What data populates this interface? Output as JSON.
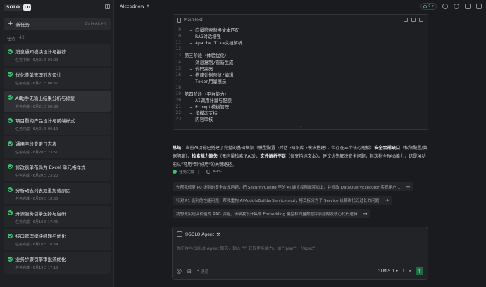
{
  "sidebar": {
    "logo_text": "SOLO",
    "logo_badge": "CD",
    "new_task": {
      "label": "新任务",
      "shortcut": "Ctrl+Alt+N"
    },
    "task_count_label": "任务",
    "task_count": "43",
    "tasks": [
      {
        "title": "消息通知模块设计与推荐",
        "meta": "任务中断 · 6月21日 03:09",
        "status": "done",
        "active": false
      },
      {
        "title": "优化菜单管理列表设计",
        "meta": "任务完成 · 6月21日 00:52",
        "status": "done",
        "active": false
      },
      {
        "title": "AI助手无输出结果分析与修复",
        "meta": "任务完成 · 6月21日 00:36",
        "status": "done",
        "active": true
      },
      {
        "title": "项目重构产品设计与前端样式",
        "meta": "任务完成 · 6月21日 00:19",
        "status": "done",
        "active": false
      },
      {
        "title": "通用字段变更日志表",
        "meta": "任务完成 · 6月20日 23:51",
        "status": "done",
        "active": false
      },
      {
        "title": "修改表单布局为 Excel 单元格样式",
        "meta": "任务完成 · 6月20日 23:20",
        "status": "done",
        "active": false
      },
      {
        "title": "分析动态列表双重加载原因",
        "meta": "任务完成 · 6月20日 18:50",
        "status": "done",
        "active": false
      },
      {
        "title": "开源服务引擎选择与启研",
        "meta": "任务完成 · 6月18日 17:45",
        "status": "done",
        "active": false
      },
      {
        "title": "接口管理模块问题与优化",
        "meta": "任务完成 · 6月18日 16:54",
        "status": "done",
        "active": false
      },
      {
        "title": "业务步骤引擎审批流优化",
        "meta": "任务完成 · 6月15日 17:15",
        "status": "done",
        "active": false
      }
    ]
  },
  "topbar": {
    "project": "AIccodnew",
    "pill_count": "0"
  },
  "code_block": {
    "lang": "PlainText",
    "lines": [
      {
        "n": "9",
        "t": "  → 向量检索替换文本匹配"
      },
      {
        "n": "10",
        "t": "  → RAG对话增强"
      },
      {
        "n": "11",
        "t": "  → Apache Tika文档解析"
      },
      {
        "n": "12",
        "t": ""
      },
      {
        "n": "13",
        "t": "第三阶段（体验优化）："
      },
      {
        "n": "14",
        "t": "  → 消息复制/重新生成"
      },
      {
        "n": "15",
        "t": "  → 代码高亮"
      },
      {
        "n": "16",
        "t": "  → 搭建计划预览/编辑"
      },
      {
        "n": "17",
        "t": "  → Token用量展示"
      },
      {
        "n": "18",
        "t": ""
      },
      {
        "n": "19",
        "t": "第四阶段（平台能力）："
      },
      {
        "n": "20",
        "t": "  → AI调用计量与配额"
      },
      {
        "n": "21",
        "t": "  → Prompt模板管理"
      },
      {
        "n": "22",
        "t": "  → 多模态支持"
      },
      {
        "n": "23",
        "t": "  → 内容审核"
      }
    ]
  },
  "summary": {
    "p1": "总结",
    "p2": "：当前AI功能已搭建了完整的基础框架（模型配置→对话→知识库→模块搭建），但存在三个核心短板：",
    "p3": "安全合规缺口",
    "p4": "（权限配置/数据隔离）、",
    "p5": "检索能力缺失",
    "p6": "（无向量检索/RAG）、",
    "p7": "文件解析不足",
    "p8": "（仅支持纯文本）。建议优先解决安全问题，其次补全RAG能力，这是AI功能从\"可用\"到\"好用\"的关键路径。"
  },
  "status": {
    "label": "任务完成",
    "progress": "49%"
  },
  "suggestions": [
    "先帮我修复 P0 级别的安全合规问题，把 SecurityConfig 里的 AI 端点权限配置加上，并修改 DataQueryExecutor 实现用户...",
    "针对 P1 级别的性能问题，帮我重构 AiModuleBuilderServiceImpl，将其拆分为子 Service 以解决代码过长的问题",
    "我想先实现高价值的 RAG 功能，请帮我设计集成 Embedding 模型和向量数据库表结构及核心代码逻辑"
  ],
  "chat": {
    "agent": "@SOLO Agent",
    "placeholder": "你正在与 SOLO Agent 聊天，输入 \"/\" 获取更多能力，如 \"/plan\"、\"/spec\"",
    "option": "通道",
    "model": "GLM-5.1"
  }
}
